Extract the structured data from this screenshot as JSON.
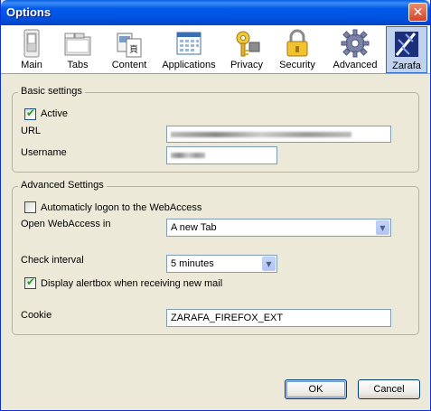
{
  "window": {
    "title": "Options",
    "close_glyph": "✕"
  },
  "toolbar": {
    "items": [
      {
        "label": "Main",
        "icon": "light-switch-icon"
      },
      {
        "label": "Tabs",
        "icon": "folders-icon"
      },
      {
        "label": "Content",
        "icon": "content-pages-icon"
      },
      {
        "label": "Applications",
        "icon": "applications-window-icon"
      },
      {
        "label": "Privacy",
        "icon": "key-lock-icon"
      },
      {
        "label": "Security",
        "icon": "padlock-icon"
      },
      {
        "label": "Advanced",
        "icon": "gear-icon"
      },
      {
        "label": "Zarafa",
        "icon": "zarafa-logo-icon",
        "selected": true
      }
    ]
  },
  "basic": {
    "title": "Basic settings",
    "active_label": "Active",
    "active_checked": true,
    "url_label": "URL",
    "username_label": "Username"
  },
  "advanced": {
    "title": "Advanced Settings",
    "autologon_label": "Automaticly logon to the WebAccess",
    "autologon_checked": false,
    "open_label": "Open WebAccess in",
    "open_value": "A new Tab",
    "interval_label": "Check interval",
    "interval_value": "5 minutes",
    "alert_label": "Display alertbox when receiving new mail",
    "alert_checked": true,
    "cookie_label": "Cookie",
    "cookie_value": "ZARAFA_FIREFOX_EXT"
  },
  "buttons": {
    "ok": "OK",
    "cancel": "Cancel"
  }
}
